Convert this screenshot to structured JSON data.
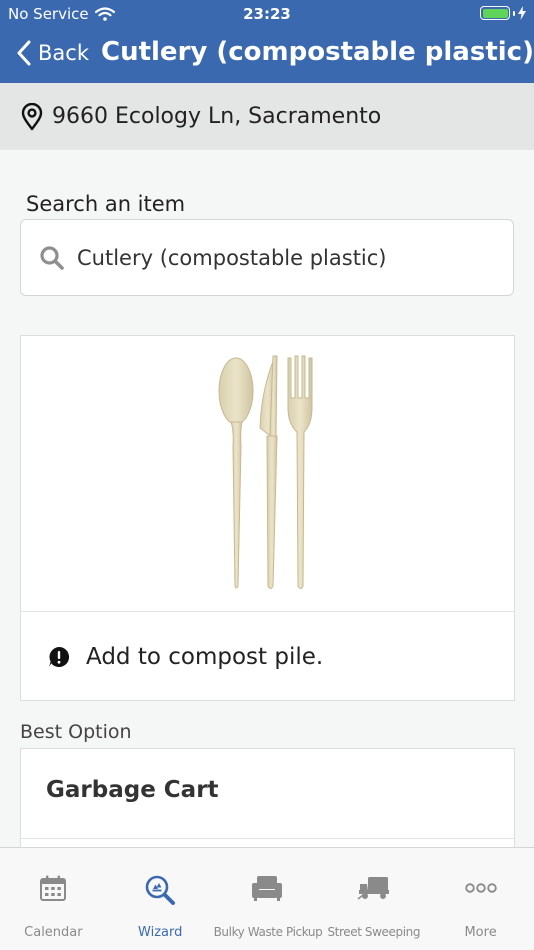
{
  "status_bar": {
    "carrier": "No Service",
    "time": "23:23"
  },
  "nav": {
    "back_label": "Back",
    "title": "Cutlery (compostable plastic)"
  },
  "address": {
    "icon": "map-pin-icon",
    "text": "9660 Ecology Ln, Sacramento"
  },
  "search": {
    "label": "Search an item",
    "value": "Cutlery (compostable plastic)",
    "icon": "search-icon"
  },
  "item": {
    "tip_icon": "alert-bubble-icon",
    "tip_text": "Add to compost pile."
  },
  "best_option": {
    "label": "Best Option",
    "title": "Garbage Cart"
  },
  "tabs": [
    {
      "label": "Calendar",
      "icon": "calendar-icon",
      "active": false
    },
    {
      "label": "Wizard",
      "icon": "search-recycle-icon",
      "active": true
    },
    {
      "label": "Bulky Waste Pickup",
      "icon": "armchair-icon",
      "active": false
    },
    {
      "label": "Street Sweeping",
      "icon": "street-sweeper-icon",
      "active": false
    },
    {
      "label": "More",
      "icon": "more-dots-icon",
      "active": false
    }
  ],
  "colors": {
    "primary": "#3b69b0",
    "tab_inactive": "#8a8a8a",
    "background": "#f5f6f6"
  }
}
